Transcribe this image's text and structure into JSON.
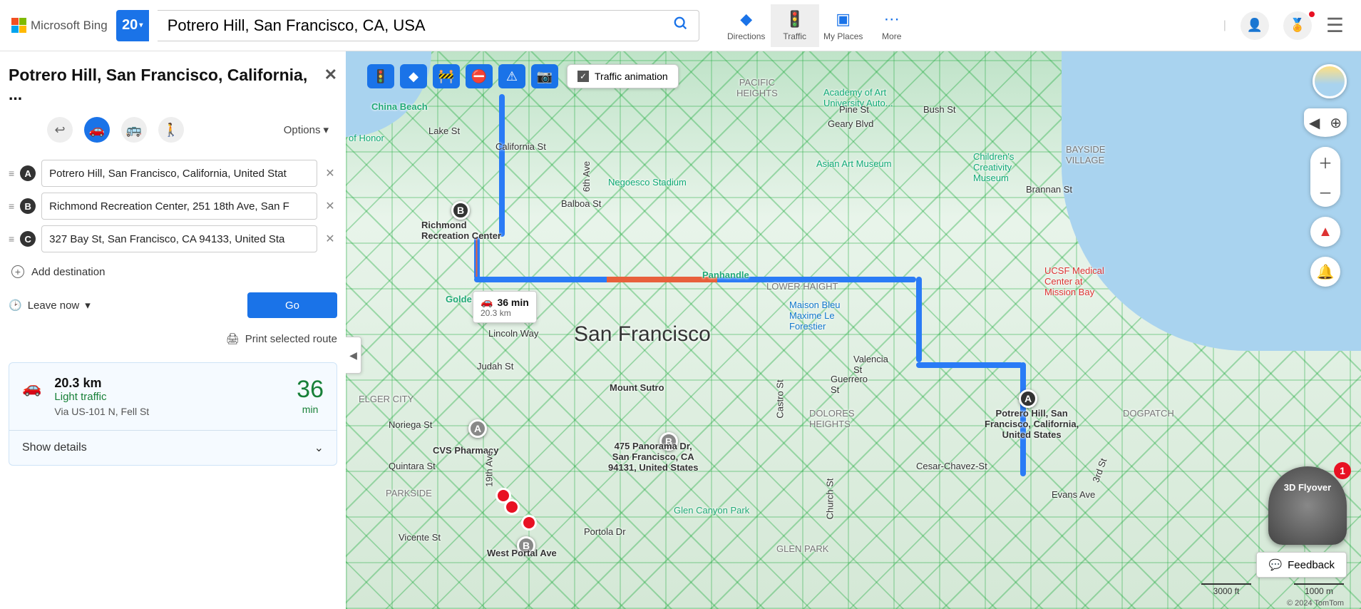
{
  "header": {
    "logo_text": "Microsoft Bing",
    "badge": "20",
    "search_value": "Potrero Hill, San Francisco, CA, USA",
    "nav": {
      "directions": "Directions",
      "traffic": "Traffic",
      "myplaces": "My Places",
      "more": "More"
    }
  },
  "panel": {
    "title": "Potrero Hill, San Francisco, California, ...",
    "options_label": "Options",
    "waypoints": [
      {
        "letter": "A",
        "value": "Potrero Hill, San Francisco, California, United Stat"
      },
      {
        "letter": "B",
        "value": "Richmond Recreation Center, 251 18th Ave, San F"
      },
      {
        "letter": "C",
        "value": "327 Bay St, San Francisco, CA 94133, United Sta"
      }
    ],
    "add_destination": "Add destination",
    "leave_now": "Leave now",
    "go": "Go",
    "print": "Print selected route",
    "route": {
      "distance": "20.3 km",
      "traffic": "Light traffic",
      "via": "Via US-101 N, Fell St",
      "minutes": "36",
      "min_label": "min",
      "show_details": "Show details"
    }
  },
  "map": {
    "traffic_animation": "Traffic animation",
    "city_label": "San Francisco",
    "route_popup": {
      "time": "36 min",
      "dist": "20.3 km"
    },
    "labels": {
      "richmond": "Richmond\nRecreation Center",
      "potrero": "Potrero Hill, San\nFrancisco, California,\nUnited States",
      "panorama": "475 Panorama Dr,\nSan Francisco, CA\n94131, United States",
      "cvs": "CVS Pharmacy",
      "westportal": "West Portal Ave",
      "pacific_heights": "PACIFIC\nHEIGHTS",
      "academy": "Academy of Art\nUniversity Auto...",
      "asian": "Asian Art Museum",
      "creativity": "Children's\nCreativity\nMuseum",
      "ucsf": "UCSF Medical\nCenter at\nMission Bay",
      "bayside": "BAYSIDE\nVILLAGE",
      "dogpatch": "DOGPATCH",
      "maison": "Maison Bleu\nMaxime Le\nForestier",
      "negoesco": "Negoesco Stadium",
      "panhandle": "Panhandle",
      "lowerhaight": "LOWER HAIGHT",
      "dolores": "DOLORES\nHEIGHTS",
      "glencanyon": "Glen Canyon Park",
      "glenpark": "GLEN PARK",
      "parkside": "PARKSIDE",
      "elgercity": "ELGER CITY",
      "sutro": "Mount Sutro",
      "china_beach": "China Beach",
      "honor": "of Honor",
      "golde": "Golde",
      "chavez": "Cesar-Chavez-St",
      "geary": "Geary Blvd",
      "pine": "Pine St",
      "bush": "Bush St",
      "california": "California St",
      "balboa": "Balboa St",
      "lake": "Lake St",
      "judah": "Judah St",
      "noriega": "Noriega St",
      "quintara": "Quintara St",
      "vicente": "Vicente St",
      "lincoln": "Lincoln Way",
      "brannan": "Brannan St",
      "portola": "Portola Dr",
      "evans": "Evans Ave",
      "valencia": "Valencia\nSt",
      "guerrero": "Guerrero\nSt",
      "church": "Church St",
      "castro": "Castro St",
      "nineteenth": "19th Ave",
      "sixth": "6th Ave",
      "third": "3rd St"
    },
    "flyover": "3D Flyover",
    "flyover_badge": "1",
    "feedback": "Feedback",
    "scale_ft": "3000 ft",
    "scale_m": "1000 m",
    "copyright": "© 2024 TomTom"
  }
}
